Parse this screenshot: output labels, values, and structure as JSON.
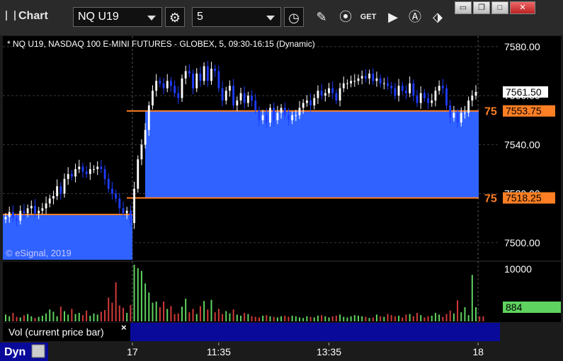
{
  "window": {
    "title": "Chart"
  },
  "toolbar": {
    "symbol": "NQ U19",
    "interval": "5",
    "get_label": "GET",
    "tools": [
      "settings-icon",
      "clock-icon",
      "pencil-icon",
      "study-icon",
      "get-data-icon",
      "play-icon",
      "alert-icon",
      "link-icon"
    ]
  },
  "header": {
    "description": "* NQ U19, NASDAQ 100 E-MINI FUTURES - GLOBEX, 5, 09:30-16:15 (Dynamic)"
  },
  "watermark": "© eSignal, 2019",
  "price_axis": {
    "ticks": [
      "7580.00",
      "7560.00",
      "7540.00",
      "7520.00",
      "7500.00"
    ]
  },
  "price_tags": {
    "last": "7561.50",
    "level_upper": "7553.75",
    "level_lower": "7518.25",
    "level_marker": "75"
  },
  "volume_panel": {
    "tick": "10000",
    "last_volume": "884",
    "label": "Vol (current price bar)",
    "close_glyph": "×"
  },
  "time_axis": {
    "ticks": [
      "17",
      "11:35",
      "13:35",
      "18"
    ]
  },
  "status": {
    "mode": "Dyn"
  },
  "colors": {
    "up": "#ffffff",
    "down": "#1f3cff",
    "zone": "#2f62ff",
    "level": "#ff7f24",
    "vol_up": "#5fd35f",
    "vol_down": "#d23a3a",
    "panel_bg": "#000000",
    "axis_bg": "#0a0a9a"
  },
  "chart_data": {
    "type": "candlestick",
    "title": "",
    "y_range": [
      7493,
      7584
    ],
    "volume_range": [
      0,
      10000
    ],
    "levels": [
      7553.75,
      7518.25,
      7511.5
    ],
    "closes": [
      7510.5,
      7512.5,
      7510,
      7509,
      7513,
      7512,
      7514,
      7515,
      7512,
      7513,
      7514,
      7516,
      7518,
      7519,
      7523,
      7520,
      7526,
      7528,
      7527,
      7530,
      7531,
      7529,
      7528,
      7530,
      7530,
      7531,
      7530,
      7526,
      7522,
      7520,
      7518,
      7514,
      7512,
      7513,
      7508,
      7522,
      7534,
      7540,
      7546,
      7556,
      7562,
      7566,
      7565,
      7563,
      7566,
      7564,
      7561,
      7559,
      7567,
      7570,
      7569,
      7563,
      7569,
      7566,
      7572,
      7566,
      7571,
      7570,
      7563,
      7558,
      7562,
      7564,
      7556,
      7558,
      7561,
      7557,
      7560,
      7558,
      7554,
      7550,
      7552,
      7549,
      7555,
      7550,
      7553,
      7555,
      7552,
      7550,
      7552,
      7552,
      7555,
      7557,
      7558,
      7556,
      7559,
      7562,
      7560,
      7561,
      7563,
      7561,
      7558,
      7563,
      7565,
      7565,
      7566,
      7566,
      7567,
      7568,
      7567,
      7569,
      7566,
      7567,
      7565,
      7565,
      7564,
      7563,
      7560,
      7564,
      7562,
      7561,
      7565,
      7560,
      7557,
      7561,
      7559,
      7557,
      7558,
      7562,
      7564,
      7563,
      7556,
      7551,
      7553,
      7549,
      7553,
      7553,
      7558,
      7560,
      7561.5
    ],
    "volumes": [
      1200,
      900,
      1500,
      800,
      700,
      1100,
      1300,
      900,
      600,
      800,
      1000,
      1400,
      2100,
      1700,
      900,
      2600,
      1800,
      1200,
      2200,
      1300,
      1500,
      1100,
      1900,
      1000,
      1400,
      1200,
      1700,
      2000,
      4200,
      3300,
      6900,
      2800,
      2400,
      1500,
      2900,
      10000,
      9400,
      8900,
      6700,
      5100,
      3300,
      3500,
      2500,
      3500,
      2200,
      2700,
      1300,
      1400,
      2600,
      4000,
      1600,
      2200,
      1300,
      2700,
      3600,
      2100,
      3800,
      1600,
      2200,
      1300,
      1800,
      1400,
      2100,
      1200,
      1000,
      1500,
      1300,
      900,
      800,
      700,
      1000,
      1100,
      900,
      800,
      700,
      900,
      1000,
      800,
      1000,
      900,
      700,
      600,
      900,
      800,
      700,
      1000,
      1100,
      900,
      700,
      900,
      1000,
      1200,
      800,
      700,
      900,
      1100,
      1000,
      900,
      800,
      600,
      700,
      1200,
      900,
      800,
      1300,
      1100,
      900,
      1000,
      700,
      1200,
      1300,
      900,
      1500,
      1100,
      700,
      900,
      1000,
      1500,
      1200,
      800,
      1300,
      1900,
      1400,
      3700,
      1600,
      2500,
      1100,
      8200,
      2500,
      900,
      884
    ]
  }
}
